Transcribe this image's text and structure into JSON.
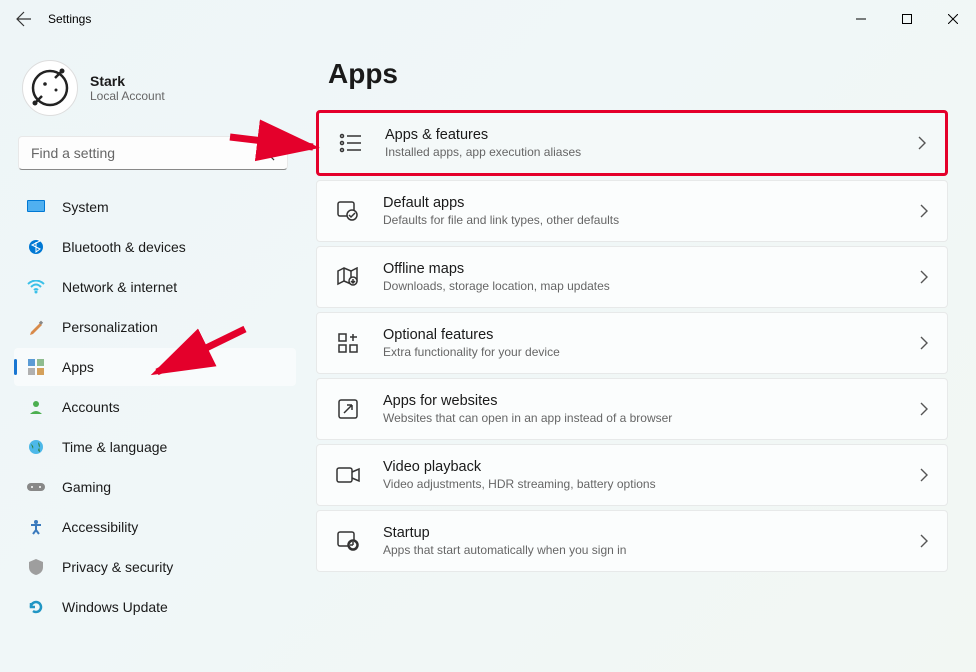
{
  "window": {
    "title": "Settings"
  },
  "profile": {
    "name": "Stark",
    "sub": "Local Account"
  },
  "search": {
    "placeholder": "Find a setting"
  },
  "nav": [
    {
      "label": "System"
    },
    {
      "label": "Bluetooth & devices"
    },
    {
      "label": "Network & internet"
    },
    {
      "label": "Personalization"
    },
    {
      "label": "Apps"
    },
    {
      "label": "Accounts"
    },
    {
      "label": "Time & language"
    },
    {
      "label": "Gaming"
    },
    {
      "label": "Accessibility"
    },
    {
      "label": "Privacy & security"
    },
    {
      "label": "Windows Update"
    }
  ],
  "page": {
    "title": "Apps"
  },
  "cards": [
    {
      "title": "Apps & features",
      "sub": "Installed apps, app execution aliases"
    },
    {
      "title": "Default apps",
      "sub": "Defaults for file and link types, other defaults"
    },
    {
      "title": "Offline maps",
      "sub": "Downloads, storage location, map updates"
    },
    {
      "title": "Optional features",
      "sub": "Extra functionality for your device"
    },
    {
      "title": "Apps for websites",
      "sub": "Websites that can open in an app instead of a browser"
    },
    {
      "title": "Video playback",
      "sub": "Video adjustments, HDR streaming, battery options"
    },
    {
      "title": "Startup",
      "sub": "Apps that start automatically when you sign in"
    }
  ]
}
